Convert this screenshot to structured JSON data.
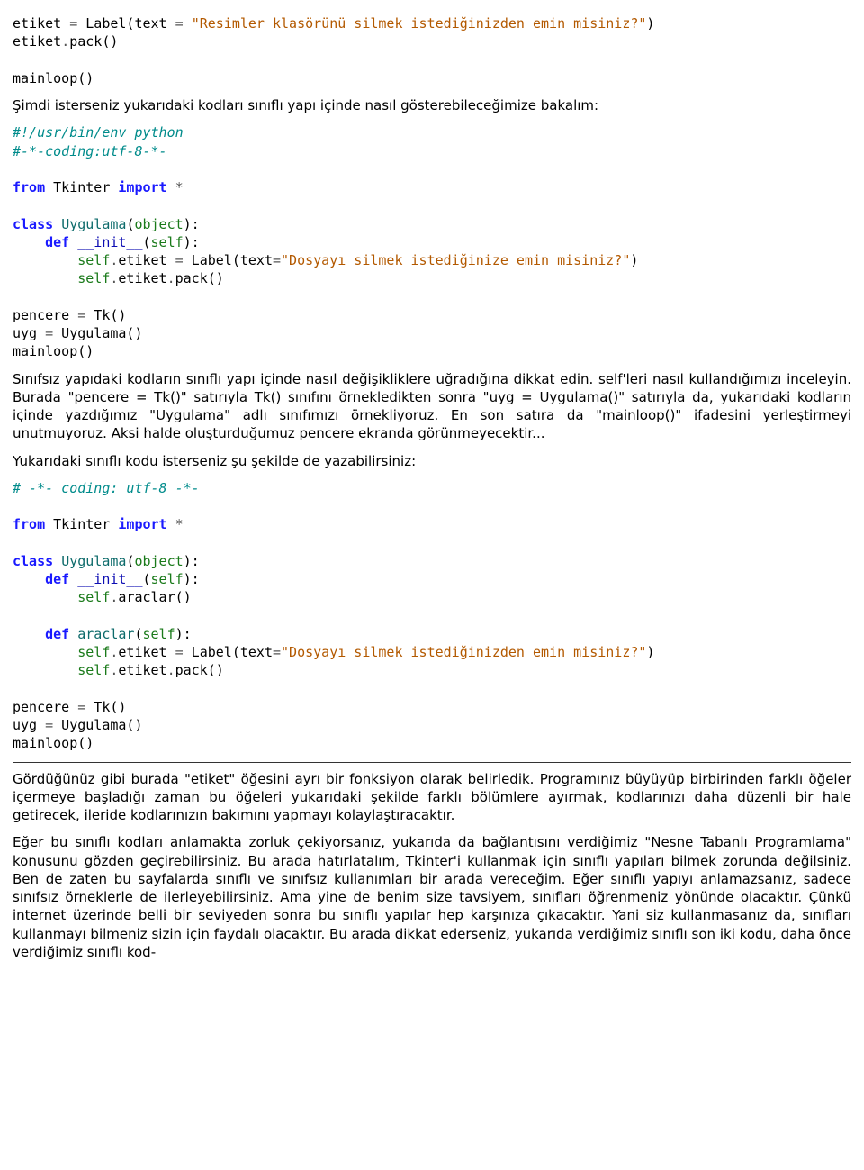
{
  "code1": {
    "l1": "etiket = Label(text = \"Resimler klasörünü silmek istediğinizden emin misiniz?\")",
    "l1a": "etiket ",
    "l1b": "=",
    "l1c": " Label(text ",
    "l1d": "=",
    "l1e": " ",
    "l1f": "\"Resimler klasörünü silmek istediğinizden emin misiniz?\"",
    "l1g": ")",
    "l2a": "etiket",
    "l2b": ".",
    "l2c": "pack()",
    "l3": "mainloop()"
  },
  "p1": "Şimdi isterseniz yukarıdaki kodları sınıflı yapı içinde nasıl gösterebileceğimize bakalım:",
  "code2": {
    "c1": "#!/usr/bin/env python",
    "c2": "#-*-coding:utf-8-*-",
    "l1a": "from",
    "l1b": " Tkinter ",
    "l1c": "import",
    "l1d": " *",
    "l2a": "class",
    "l2b": " ",
    "l2c": "Uygulama",
    "l2d": "(",
    "l2e": "object",
    "l2f": "):",
    "l3a": "    ",
    "l3b": "def",
    "l3c": " ",
    "l3d": "__init__",
    "l3e": "(",
    "l3f": "self",
    "l3g": "):",
    "l4a": "        ",
    "l4b": "self",
    "l4c": ".",
    "l4d": "etiket ",
    "l4e": "=",
    "l4f": " Label(text",
    "l4g": "=",
    "l4h": "\"Dosyayı silmek istediğinize emin misiniz?\"",
    "l4i": ")",
    "l5a": "        ",
    "l5b": "self",
    "l5c": ".",
    "l5d": "etiket",
    "l5e": ".",
    "l5f": "pack()",
    "l6a": "pencere ",
    "l6b": "=",
    "l6c": " Tk()",
    "l7a": "uyg ",
    "l7b": "=",
    "l7c": " Uygulama()",
    "l8": "mainloop()"
  },
  "p2": "Sınıfsız yapıdaki kodların sınıflı yapı içinde nasıl değişikliklere uğradığına dikkat edin. self'leri nasıl kullandığımızı inceleyin. Burada \"pencere = Tk()\" satırıyla Tk() sınıfını örnekledikten sonra \"uyg = Uygulama()\" satırıyla da, yukarıdaki kodların içinde yazdığımız \"Uygulama\" adlı sınıfımızı örnekliyoruz. En son satıra da \"mainloop()\" ifadesini yerleştirmeyi unutmuyoruz. Aksi halde oluşturduğumuz pencere ekranda görünmeyecektir...",
  "p3": "Yukarıdaki sınıflı kodu isterseniz şu şekilde de yazabilirsiniz:",
  "code3": {
    "c1": "# -*- coding: utf-8 -*-",
    "l1a": "from",
    "l1b": " Tkinter ",
    "l1c": "import",
    "l1d": " *",
    "l2a": "class",
    "l2b": " ",
    "l2c": "Uygulama",
    "l2d": "(",
    "l2e": "object",
    "l2f": "):",
    "l3a": "    ",
    "l3b": "def",
    "l3c": " ",
    "l3d": "__init__",
    "l3e": "(",
    "l3f": "self",
    "l3g": "):",
    "l4a": "        ",
    "l4b": "self",
    "l4c": ".",
    "l4d": "araclar()",
    "l5a": "    ",
    "l5b": "def",
    "l5c": " ",
    "l5d": "araclar",
    "l5e": "(",
    "l5f": "self",
    "l5g": "):",
    "l6a": "        ",
    "l6b": "self",
    "l6c": ".",
    "l6d": "etiket ",
    "l6e": "=",
    "l6f": " Label(text",
    "l6g": "=",
    "l6h": "\"Dosyayı silmek istediğinizden emin misiniz?\"",
    "l6i": ")",
    "l7a": "        ",
    "l7b": "self",
    "l7c": ".",
    "l7d": "etiket",
    "l7e": ".",
    "l7f": "pack()",
    "l8a": "pencere ",
    "l8b": "=",
    "l8c": " Tk()",
    "l9a": "uyg ",
    "l9b": "=",
    "l9c": " Uygulama()",
    "l10": "mainloop()"
  },
  "p4": "Gördüğünüz gibi burada \"etiket\" öğesini ayrı bir fonksiyon olarak belirledik. Programınız büyüyüp birbirinden farklı öğeler içermeye başladığı zaman bu öğeleri yukarıdaki şekilde farklı bölümlere ayırmak, kodlarınızı daha düzenli bir hale getirecek, ileride kodlarınızın bakımını yapmayı kolaylaştıracaktır.",
  "p5": "Eğer bu sınıflı kodları anlamakta zorluk çekiyorsanız, yukarıda da bağlantısını verdiğimiz \"Nesne Tabanlı Programlama\" konusunu gözden geçirebilirsiniz. Bu arada hatırlatalım, Tkinter'i kullanmak için sınıflı yapıları bilmek zorunda değilsiniz. Ben de zaten bu sayfalarda sınıflı ve sınıfsız kullanımları bir arada vereceğim. Eğer sınıflı yapıyı anlamazsanız, sadece sınıfsız örneklerle de ilerleyebilirsiniz. Ama yine de benim size tavsiyem, sınıfları öğrenmeniz yönünde olacaktır. Çünkü internet üzerinde belli bir seviyeden sonra bu sınıflı yapılar hep karşınıza çıkacaktır. Yani siz kullanmasanız da, sınıfları kullanmayı bilmeniz sizin için faydalı olacaktır. Bu arada dikkat ederseniz, yukarıda verdiğimiz sınıflı son iki kodu, daha önce verdiğimiz sınıflı kod-"
}
